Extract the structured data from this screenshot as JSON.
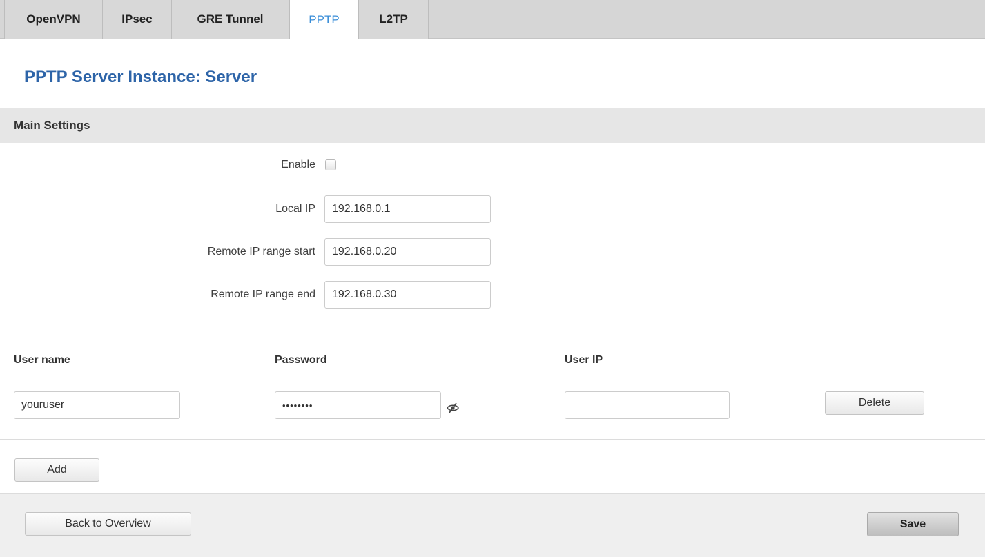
{
  "tabs": [
    {
      "label": "OpenVPN",
      "active": false
    },
    {
      "label": "IPsec",
      "active": false
    },
    {
      "label": "GRE Tunnel",
      "active": false
    },
    {
      "label": "PPTP",
      "active": true
    },
    {
      "label": "L2TP",
      "active": false
    }
  ],
  "page_title": "PPTP Server Instance: Server",
  "main_settings": {
    "header": "Main Settings",
    "enable_label": "Enable",
    "enable_checked": false,
    "local_ip_label": "Local IP",
    "local_ip_value": "192.168.0.1",
    "remote_start_label": "Remote IP range start",
    "remote_start_value": "192.168.0.20",
    "remote_end_label": "Remote IP range end",
    "remote_end_value": "192.168.0.30"
  },
  "users_table": {
    "columns": [
      "User name",
      "Password",
      "User IP"
    ],
    "rows": [
      {
        "username": "youruser",
        "password_masked": "••••••••",
        "user_ip": "",
        "delete_label": "Delete"
      }
    ],
    "add_label": "Add"
  },
  "footer": {
    "back_label": "Back to Overview",
    "save_label": "Save"
  },
  "colors": {
    "title": "#2d64a8",
    "active_tab": "#3a8ed8"
  },
  "icons": {
    "password_toggle": "eye-slash-icon"
  }
}
